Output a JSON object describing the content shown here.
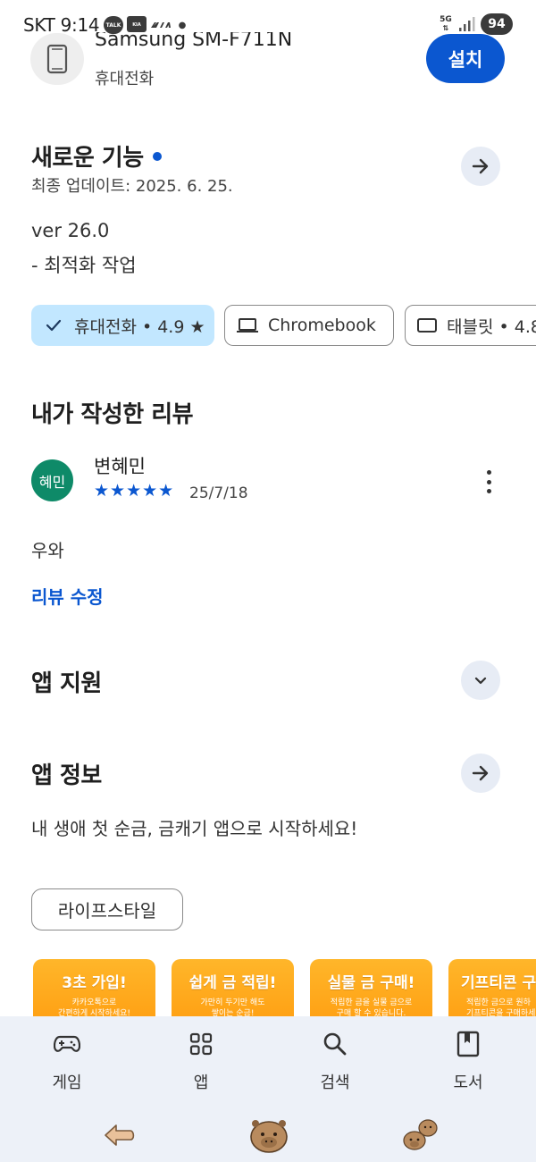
{
  "status_bar": {
    "carrier_time": "SKT 9:14",
    "talk_label": "TALK",
    "kia_connect_label": "Kia Connect",
    "kia_logo": "KIA",
    "network_label": "5G",
    "battery": "94"
  },
  "app": {
    "name": "Samsung SM-F711N",
    "category": "휴대전화",
    "install_label": "설치",
    "icon": "phone-icon"
  },
  "whats_new": {
    "title": "새로운 기능",
    "updated": "최종 업데이트: 2025. 6. 25.",
    "version": "ver 26.0",
    "note": "- 최적화 작업"
  },
  "device_chips": [
    {
      "label": "휴대전화 • 4.9 ★",
      "selected": true,
      "icon": "check-icon"
    },
    {
      "label": "Chromebook",
      "selected": false,
      "icon": "laptop-icon"
    },
    {
      "label": "태블릿 • 4.8",
      "selected": false,
      "icon": "tablet-icon"
    }
  ],
  "my_review": {
    "title": "내가 작성한 리뷰",
    "avatar_text": "혜민",
    "reviewer": "변혜민",
    "stars": "★★★★★",
    "rating": 5,
    "date": "25/7/18",
    "text": "우와",
    "edit_label": "리뷰 수정"
  },
  "app_support": {
    "title": "앱 지원"
  },
  "app_info": {
    "title": "앱 정보",
    "description": "내 생애 첫 순금, 금캐기 앱으로 시작하세요!",
    "category_chip": "라이프스타일"
  },
  "banners": [
    {
      "title": "3초 가입!",
      "line1": "카카오톡으로",
      "line2": "간편하게 시작하세요!"
    },
    {
      "title": "쉽게 금 적립!",
      "line1": "가만히 두기만 해도",
      "line2": "쌓이는 순금!"
    },
    {
      "title": "실물 금 구매!",
      "line1": "적립한 금을 실물 금으로",
      "line2": "구매 할 수 있습니다."
    },
    {
      "title": "기프티콘 구",
      "line1": "적립한 금으로 원하",
      "line2": "기프티콘을 구매하세"
    }
  ],
  "bottom_nav": [
    {
      "label": "게임",
      "icon": "gamepad-icon"
    },
    {
      "label": "앱",
      "icon": "apps-grid-icon"
    },
    {
      "label": "검색",
      "icon": "search-icon"
    },
    {
      "label": "도서",
      "icon": "book-icon"
    }
  ],
  "colors": {
    "accent": "#0b57d0",
    "chip_selected": "#c2e7ff",
    "avatar": "#0e8a68",
    "nav_background": "#edf1f8",
    "banner": "#ffa51c"
  }
}
